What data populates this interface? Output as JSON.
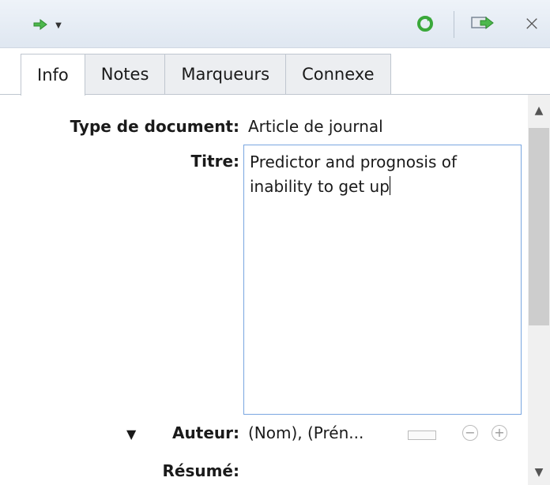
{
  "toolbar": {
    "close_glyph": "×"
  },
  "tabs": [
    {
      "label": "Info"
    },
    {
      "label": "Notes"
    },
    {
      "label": "Marqueurs"
    },
    {
      "label": "Connexe"
    }
  ],
  "fields": {
    "item_type_label": "Type de document:",
    "item_type_value": "Article de journal",
    "title_label": "Titre:",
    "title_line1": "Predictor and prognosis of",
    "title_line2": "inability to get up",
    "author_label": "Auteur:",
    "author_value": "(Nom), (Prén...",
    "abstract_label": "Résumé:"
  },
  "colors": {
    "accent": "#7aa6e0",
    "green_icon": "#3aa83a"
  }
}
